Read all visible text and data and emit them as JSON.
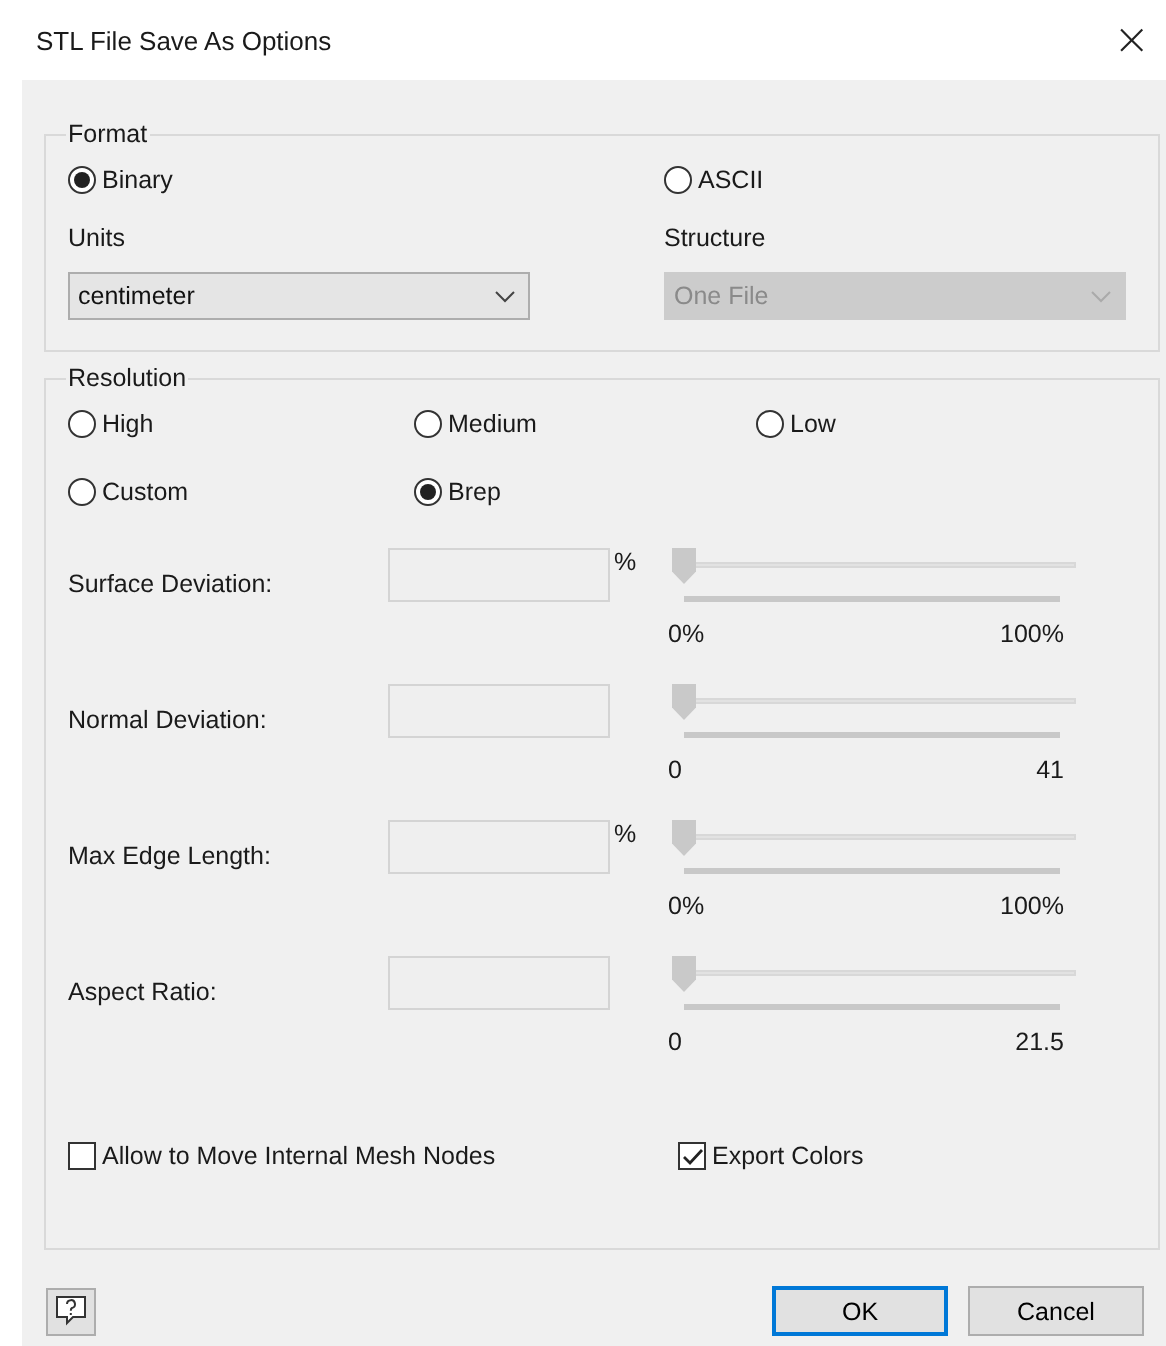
{
  "window": {
    "title": "STL File Save As Options",
    "close": "×"
  },
  "format": {
    "legend": "Format",
    "options": [
      {
        "label": "Binary",
        "selected": true
      },
      {
        "label": "ASCII",
        "selected": false
      }
    ],
    "units": {
      "label": "Units",
      "value": "centimeter",
      "disabled": false
    },
    "structure": {
      "label": "Structure",
      "value": "One File",
      "disabled": true
    }
  },
  "resolution": {
    "legend": "Resolution",
    "options": [
      {
        "label": "High",
        "selected": false
      },
      {
        "label": "Medium",
        "selected": false
      },
      {
        "label": "Low",
        "selected": false
      },
      {
        "label": "Custom",
        "selected": false
      },
      {
        "label": "Brep",
        "selected": true
      }
    ],
    "parameters": [
      {
        "label": "Surface Deviation:",
        "unit": "%",
        "level": 0,
        "min": "0%",
        "max": "100%"
      },
      {
        "label": "Normal Deviation:",
        "level": 0,
        "min": "0",
        "max": "41"
      },
      {
        "label": "Max Edge Length:",
        "unit": "%",
        "level": 0,
        "min": "0%",
        "max": "100%"
      },
      {
        "label": "Aspect Ratio:",
        "level": 0,
        "min": "0",
        "max": "21.5"
      }
    ],
    "checkboxes": [
      {
        "label": "Allow to Move Internal Mesh Nodes",
        "checked": false
      },
      {
        "label": "Export Colors",
        "checked": true
      }
    ]
  },
  "buttons": [
    {
      "label": "OK",
      "default": true
    },
    {
      "label": "Cancel",
      "default": false
    }
  ]
}
